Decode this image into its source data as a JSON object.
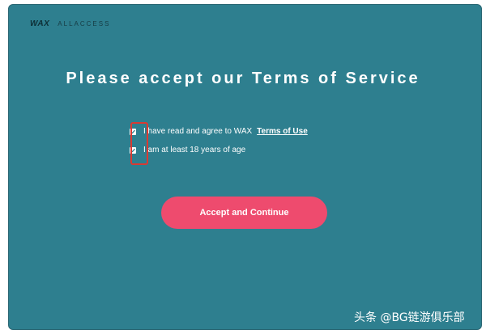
{
  "brand": {
    "logo": "WAX",
    "product": "ALLACCESS"
  },
  "title": "Please accept our Terms of Service",
  "checkboxes": [
    {
      "label": "I have read and agree to WAX",
      "link": "Terms of Use",
      "checked": true
    },
    {
      "label": "I am at least 18 years of age",
      "checked": true
    }
  ],
  "accept_button": "Accept and Continue",
  "watermark": "头条 @BG链游俱乐部",
  "colors": {
    "background": "#2e7f8f",
    "button": "#ee4b6e",
    "highlight": "#d93a32"
  }
}
